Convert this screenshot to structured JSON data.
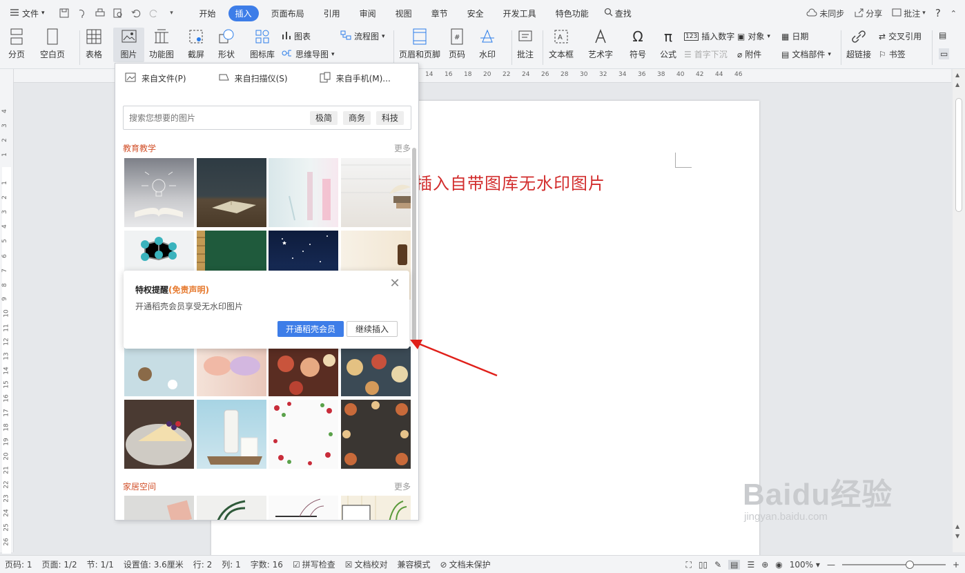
{
  "menubar": {
    "file_label": "文件",
    "tabs": [
      "开始",
      "插入",
      "页面布局",
      "引用",
      "审阅",
      "视图",
      "章节",
      "安全",
      "开发工具",
      "特色功能"
    ],
    "active_tab": "插入",
    "find_label": "查找",
    "right": {
      "sync": "未同步",
      "share": "分享",
      "comment": "批注",
      "help": "?"
    }
  },
  "ribbon": {
    "page_break": "分页",
    "blank_page": "空白页",
    "table": "表格",
    "picture": "图片",
    "function_chart": "功能图",
    "screenshot": "截屏",
    "shape": "形状",
    "icon_lib": "图标库",
    "chart": "图表",
    "mindmap": "思维导图",
    "flowchart": "流程图",
    "header_footer": "页眉和页脚",
    "page_number": "页码",
    "watermark": "水印",
    "annotation": "批注",
    "textbox": "文本框",
    "wordart": "艺术字",
    "symbol": "符号",
    "formula": "公式",
    "insert_number": "插入数字",
    "drop_cap": "首字下沉",
    "object": "对象",
    "attachment": "附件",
    "date": "日期",
    "doc_parts": "文档部件",
    "hyperlink": "超链接",
    "cross_ref": "交叉引用",
    "bookmark": "书签"
  },
  "ruler": {
    "h_ticks": [
      "14",
      "16",
      "18",
      "20",
      "22",
      "24",
      "26",
      "28",
      "30",
      "32",
      "34",
      "36",
      "38",
      "40",
      "42",
      "44",
      "46"
    ],
    "v_ticks": [
      "4",
      "3",
      "2",
      "1",
      "1",
      "2",
      "3",
      "4",
      "5",
      "6",
      "7",
      "8",
      "9",
      "10",
      "11",
      "12",
      "13",
      "14",
      "15",
      "16",
      "17",
      "18",
      "19",
      "20",
      "21",
      "22",
      "23",
      "24",
      "25",
      "26"
    ]
  },
  "document": {
    "title": "插入自带图库无水印图片"
  },
  "picture_panel": {
    "sources": [
      "来自文件(P)",
      "来自扫描仪(S)",
      "来自手机(M)..."
    ],
    "search_placeholder": "搜索您想要的图片",
    "tags": [
      "极简",
      "商务",
      "科技"
    ],
    "categories": [
      {
        "name": "教育教学",
        "more": "更多"
      },
      {
        "name": "家居空间",
        "more": "更多"
      }
    ]
  },
  "notice": {
    "title": "特权提醒",
    "title_highlight": "(免责声明)",
    "body": "开通稻壳会员享受无水印图片",
    "primary_button": "开通稻壳会员",
    "secondary_button": "继续插入"
  },
  "statusbar": {
    "page_num": "页码: 1",
    "page_count": "页面: 1/2",
    "section": "节: 1/1",
    "setting": "设置值: 3.6厘米",
    "row": "行: 2",
    "col": "列: 1",
    "word_count": "字数: 16",
    "spell_check": "拼写检查",
    "proofread": "文档校对",
    "compat": "兼容模式",
    "protection": "文档未保护",
    "zoom": "100%"
  },
  "watermark": {
    "brand": "Baidu经验",
    "url": "jingyan.baidu.com"
  },
  "colors": {
    "accent": "#3d7de8",
    "title_red": "#d22d2d",
    "category_orange": "#d2502a",
    "highlight_orange": "#e67a2f",
    "arrow_red": "#e0201a"
  }
}
